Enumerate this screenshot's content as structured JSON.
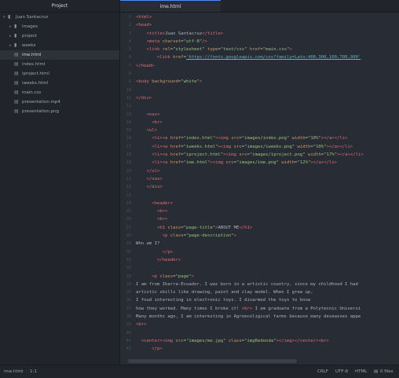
{
  "tree": {
    "header": "Project",
    "root": "Juan Santacruz",
    "folders": [
      "images",
      "project",
      "weeks"
    ],
    "files": [
      "ime.html",
      "index.html",
      "iproject.html",
      "iweeks.html",
      "main.css",
      "presentation.mp4",
      "presentation.png"
    ],
    "selected_file": "ime.html"
  },
  "tab": {
    "title": "ime.html"
  },
  "code_lines": [
    [
      [
        "t",
        "<html>"
      ]
    ],
    [
      [
        "t",
        "<head>"
      ]
    ],
    [
      [
        "p",
        "    "
      ],
      [
        "t",
        "<title>"
      ],
      [
        "p",
        "Juan Santacruz"
      ],
      [
        "t",
        "</title>"
      ]
    ],
    [
      [
        "p",
        "    "
      ],
      [
        "t",
        "<meta "
      ],
      [
        "a",
        "charset"
      ],
      [
        "p",
        "="
      ],
      [
        "s",
        "\"utf-8\""
      ],
      [
        "t",
        "/>"
      ]
    ],
    [
      [
        "p",
        "    "
      ],
      [
        "t",
        "<link "
      ],
      [
        "a",
        "rel"
      ],
      [
        "p",
        "="
      ],
      [
        "s",
        "\"stylesheet\""
      ],
      [
        "p",
        " "
      ],
      [
        "a",
        "type"
      ],
      [
        "p",
        "="
      ],
      [
        "s",
        "\"text/css\""
      ],
      [
        "p",
        " "
      ],
      [
        "a",
        "href"
      ],
      [
        "p",
        "="
      ],
      [
        "s",
        "\"main.css\""
      ],
      [
        "t",
        ">"
      ]
    ],
    [
      [
        "p",
        "        "
      ],
      [
        "t",
        "<link "
      ],
      [
        "a",
        "href"
      ],
      [
        "p",
        "="
      ],
      [
        "u",
        "'https://fonts.googleapis.com/css?family=Lato:400,300,100,700,900'"
      ]
    ],
    [
      [
        "t",
        "</head>"
      ]
    ],
    [],
    [
      [
        "t",
        "<body "
      ],
      [
        "a",
        "background"
      ],
      [
        "p",
        "="
      ],
      [
        "s",
        "\"white\""
      ],
      [
        "t",
        ">"
      ]
    ],
    [],
    [
      [
        "t",
        "</div>"
      ]
    ],
    [],
    [
      [
        "p",
        "    "
      ],
      [
        "t",
        "<nav>"
      ]
    ],
    [
      [
        "p",
        "      "
      ],
      [
        "t",
        "<br>"
      ]
    ],
    [
      [
        "p",
        "    "
      ],
      [
        "t",
        "<ul>"
      ]
    ],
    [
      [
        "p",
        "      "
      ],
      [
        "t",
        "<li><a "
      ],
      [
        "a",
        "href"
      ],
      [
        "p",
        "="
      ],
      [
        "s",
        "\"index.html\""
      ],
      [
        "t",
        "><img "
      ],
      [
        "a",
        "src"
      ],
      [
        "p",
        "="
      ],
      [
        "s",
        "\"images/index.png\""
      ],
      [
        "p",
        " "
      ],
      [
        "a",
        "width"
      ],
      [
        "p",
        "="
      ],
      [
        "s",
        "\"10%\""
      ],
      [
        "t",
        "></a></li>"
      ]
    ],
    [
      [
        "p",
        "      "
      ],
      [
        "t",
        "<li><a "
      ],
      [
        "a",
        "href"
      ],
      [
        "p",
        "="
      ],
      [
        "s",
        "\"iweeks.html\""
      ],
      [
        "t",
        "><img "
      ],
      [
        "a",
        "src"
      ],
      [
        "p",
        "="
      ],
      [
        "s",
        "\"images/iweeks.png\""
      ],
      [
        "p",
        " "
      ],
      [
        "a",
        "width"
      ],
      [
        "p",
        "="
      ],
      [
        "s",
        "\"10%\""
      ],
      [
        "t",
        "></a></li>"
      ]
    ],
    [
      [
        "p",
        "      "
      ],
      [
        "t",
        "<li><a "
      ],
      [
        "a",
        "href"
      ],
      [
        "p",
        "="
      ],
      [
        "s",
        "\"iproject.html\""
      ],
      [
        "t",
        "><img "
      ],
      [
        "a",
        "src"
      ],
      [
        "p",
        "="
      ],
      [
        "s",
        "\"images/iproject.png\""
      ],
      [
        "p",
        " "
      ],
      [
        "a",
        "width"
      ],
      [
        "p",
        "="
      ],
      [
        "s",
        "\"17%\""
      ],
      [
        "t",
        "></a></li>"
      ]
    ],
    [
      [
        "p",
        "      "
      ],
      [
        "t",
        "<li><a "
      ],
      [
        "a",
        "href"
      ],
      [
        "p",
        "="
      ],
      [
        "s",
        "\"ime.html\""
      ],
      [
        "t",
        "><img "
      ],
      [
        "a",
        "src"
      ],
      [
        "p",
        "="
      ],
      [
        "s",
        "\"images/ime.png\""
      ],
      [
        "p",
        " "
      ],
      [
        "a",
        "width"
      ],
      [
        "p",
        "="
      ],
      [
        "s",
        "\"12%\""
      ],
      [
        "t",
        "></a></li>"
      ]
    ],
    [
      [
        "p",
        "    "
      ],
      [
        "t",
        "</ul>"
      ]
    ],
    [
      [
        "p",
        "    "
      ],
      [
        "t",
        "</nav>"
      ]
    ],
    [
      [
        "p",
        "    "
      ],
      [
        "t",
        "</div>"
      ]
    ],
    [],
    [
      [
        "p",
        "      "
      ],
      [
        "t",
        "<header>"
      ]
    ],
    [
      [
        "p",
        "        "
      ],
      [
        "t",
        "<br>"
      ]
    ],
    [
      [
        "p",
        "        "
      ],
      [
        "t",
        "<br>"
      ]
    ],
    [
      [
        "p",
        "        "
      ],
      [
        "t",
        "<h1 "
      ],
      [
        "a",
        "class"
      ],
      [
        "p",
        "="
      ],
      [
        "s",
        "\"page-title\""
      ],
      [
        "t",
        ">"
      ],
      [
        "p",
        "ABOUT ME"
      ],
      [
        "t",
        "</h1>"
      ]
    ],
    [
      [
        "p",
        "          "
      ],
      [
        "t",
        "<p "
      ],
      [
        "a",
        "class"
      ],
      [
        "p",
        "="
      ],
      [
        "s",
        "\"page-description\""
      ],
      [
        "t",
        ">"
      ]
    ],
    [
      [
        "p",
        "Who am I?"
      ]
    ],
    [
      [
        "p",
        "          "
      ],
      [
        "t",
        "</p>"
      ]
    ],
    [
      [
        "p",
        "        "
      ],
      [
        "t",
        "</header>"
      ]
    ],
    [],
    [
      [
        "p",
        "      "
      ],
      [
        "t",
        "<p "
      ],
      [
        "a",
        "class"
      ],
      [
        "p",
        "="
      ],
      [
        "s",
        "\"page\""
      ],
      [
        "t",
        ">"
      ]
    ],
    [
      [
        "p",
        "I am from Ibarra-Ecuador. I was born in a artistic country, since my childhood I had"
      ]
    ],
    [
      [
        "p",
        "artistic skills like drawing, paint and clay model. When I grew up,"
      ]
    ],
    [
      [
        "p",
        "I foud interesting in electronic toys. I disarmed the toys to know"
      ]
    ],
    [
      [
        "p",
        "how they worked. Many times I broke it! "
      ],
      [
        "t",
        "<br>"
      ],
      [
        "p",
        " I am graduate from a Polytecnic Universi"
      ]
    ],
    [
      [
        "p",
        "Many months ago, I am interesting in Agroecoligical farms because many deseasses appe"
      ]
    ],
    [
      [
        "t",
        "<br>"
      ]
    ],
    [],
    [
      [
        "p",
        "  "
      ],
      [
        "t",
        "<center><img "
      ],
      [
        "a",
        "src"
      ],
      [
        "p",
        "="
      ],
      [
        "s",
        "\"images/me.jpg\""
      ],
      [
        "p",
        " "
      ],
      [
        "a",
        "class"
      ],
      [
        "p",
        "="
      ],
      [
        "s",
        "\"imgRedonda\""
      ],
      [
        "t",
        "></img></center><br>"
      ]
    ],
    [
      [
        "p",
        "      "
      ],
      [
        "t",
        "</p>"
      ]
    ]
  ],
  "status": {
    "file": "ime.html",
    "cursor": "1:1",
    "line_ending": "CRLF",
    "encoding": "UTF-8",
    "grammar": "HTML",
    "files": "0 files"
  }
}
